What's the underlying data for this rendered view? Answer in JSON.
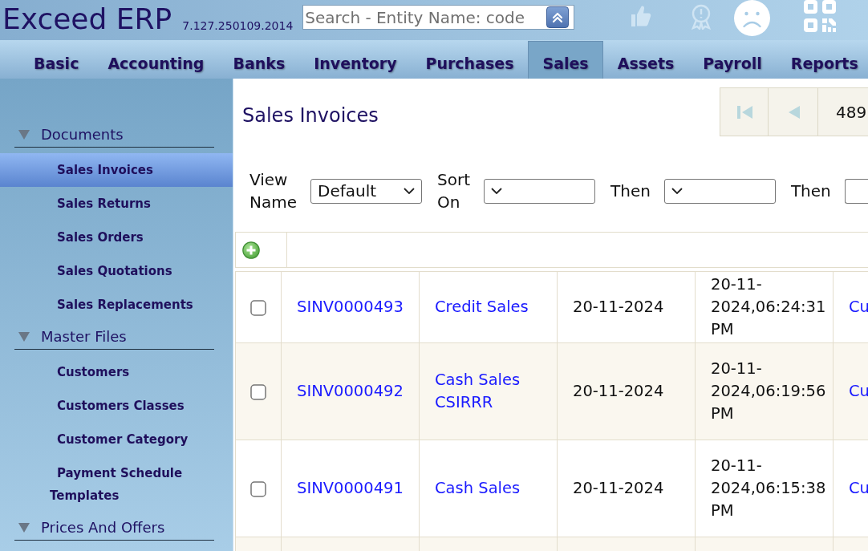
{
  "header": {
    "title": "Exceed ERP",
    "version": "7.127.250109.2014",
    "search": {
      "placeholder": "Search - Entity Name: code"
    }
  },
  "nav": {
    "tabs": [
      {
        "label": "Basic",
        "selected": false
      },
      {
        "label": "Accounting",
        "selected": false
      },
      {
        "label": "Banks",
        "selected": false
      },
      {
        "label": "Inventory",
        "selected": false
      },
      {
        "label": "Purchases",
        "selected": false
      },
      {
        "label": "Sales",
        "selected": true
      },
      {
        "label": "Assets",
        "selected": false
      },
      {
        "label": "Payroll",
        "selected": false
      },
      {
        "label": "Reports",
        "selected": false
      }
    ]
  },
  "sidebar": {
    "groups": [
      {
        "label": "Documents",
        "expanded": true,
        "items": [
          {
            "label": "Sales Invoices",
            "selected": true
          },
          {
            "label": "Sales Returns",
            "selected": false
          },
          {
            "label": "Sales Orders",
            "selected": false
          },
          {
            "label": "Sales Quotations",
            "selected": false
          },
          {
            "label": "Sales Replacements",
            "selected": false
          }
        ]
      },
      {
        "label": "Master Files",
        "expanded": true,
        "items": [
          {
            "label": "Customers",
            "selected": false
          },
          {
            "label": "Customers Classes",
            "selected": false
          },
          {
            "label": "Customer Category",
            "selected": false
          },
          {
            "label": "Payment Schedule Templates",
            "selected": false
          }
        ]
      },
      {
        "label": "Prices And Offers",
        "expanded": true
      }
    ]
  },
  "main": {
    "title": "Sales Invoices",
    "pager": {
      "buttons": [
        {
          "kind": "first",
          "disabled": true
        },
        {
          "kind": "previous",
          "disabled": true
        }
      ],
      "counter": "489"
    },
    "filters": [
      {
        "label": "View Name",
        "value": "Default"
      },
      {
        "label": "Sort On"
      },
      {
        "label": "Then"
      },
      {
        "label": "Then"
      }
    ],
    "table": {
      "columns": [
        {
          "kind": "link"
        },
        {
          "kind": "link"
        },
        {
          "kind": "text"
        },
        {
          "kind": "text"
        },
        {
          "kind": "link"
        }
      ],
      "rows": [
        {
          "checked": false,
          "cells": [
            "SINV0000493",
            "Credit Sales",
            "20-11-2024",
            "20-11-2024,06:24:31 PM",
            "Cu"
          ]
        },
        {
          "checked": false,
          "cells": [
            "SINV0000492",
            "Cash Sales CSIRRR",
            "20-11-2024",
            "20-11-2024,06:19:56 PM",
            "Cu"
          ]
        },
        {
          "checked": false,
          "cells": [
            "SINV0000491",
            "Cash Sales",
            "20-11-2024",
            "20-11-2024,06:15:38 PM",
            "Cu"
          ]
        }
      ]
    }
  }
}
